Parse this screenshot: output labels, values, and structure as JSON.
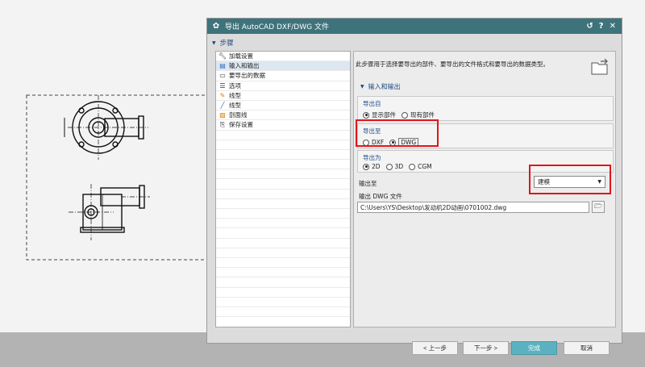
{
  "window": {
    "title": "导出 AutoCAD DXF/DWG 文件",
    "controls": [
      "↺",
      "?",
      "✕"
    ]
  },
  "steps": {
    "header": "步骤",
    "items": [
      {
        "label": "加载设置",
        "icon": "wrench-icon",
        "selected": false
      },
      {
        "label": "输入和输出",
        "icon": "input-output-icon",
        "selected": true
      },
      {
        "label": "要导出的数据",
        "icon": "data-icon",
        "selected": false
      },
      {
        "label": "选项",
        "icon": "options-icon",
        "selected": false
      },
      {
        "label": "线型",
        "icon": "linetype-icon",
        "selected": false
      },
      {
        "label": "线型",
        "icon": "line-icon",
        "selected": false
      },
      {
        "label": "剖面线",
        "icon": "hatch-icon",
        "selected": false
      },
      {
        "label": "保存设置",
        "icon": "save-settings-icon",
        "selected": false
      }
    ]
  },
  "content": {
    "description": "此步骤用于选择要导出的部件、要导出的文件格式和要导出的数据类型。",
    "section_title": "输入和输出",
    "export_from": {
      "title": "导出自",
      "options": [
        {
          "label": "显示部件",
          "checked": true
        },
        {
          "label": "现有部件",
          "checked": false
        }
      ]
    },
    "export_to": {
      "title": "导出至",
      "options": [
        {
          "label": "DXF",
          "checked": false
        },
        {
          "label": "DWG",
          "checked": true
        }
      ]
    },
    "export_as": {
      "title": "导出为",
      "options": [
        {
          "label": "2D",
          "checked": true
        },
        {
          "label": "3D",
          "checked": false
        },
        {
          "label": "CGM",
          "checked": false
        }
      ]
    },
    "output_to": {
      "label": "输出至",
      "value": "建模"
    },
    "output_file": {
      "label": "输出 DWG 文件",
      "value": "C:\\Users\\YS\\Desktop\\发动机2D动画\\0701002.dwg"
    }
  },
  "footer": {
    "prev": "< 上一步",
    "next": "下一步 >",
    "finish": "完成",
    "cancel": "取消"
  },
  "colors": {
    "titlebar": "#3e737b",
    "accent_text": "#1e4c86",
    "highlight_box": "#e0151b",
    "finish_button": "#5bb1bf"
  }
}
